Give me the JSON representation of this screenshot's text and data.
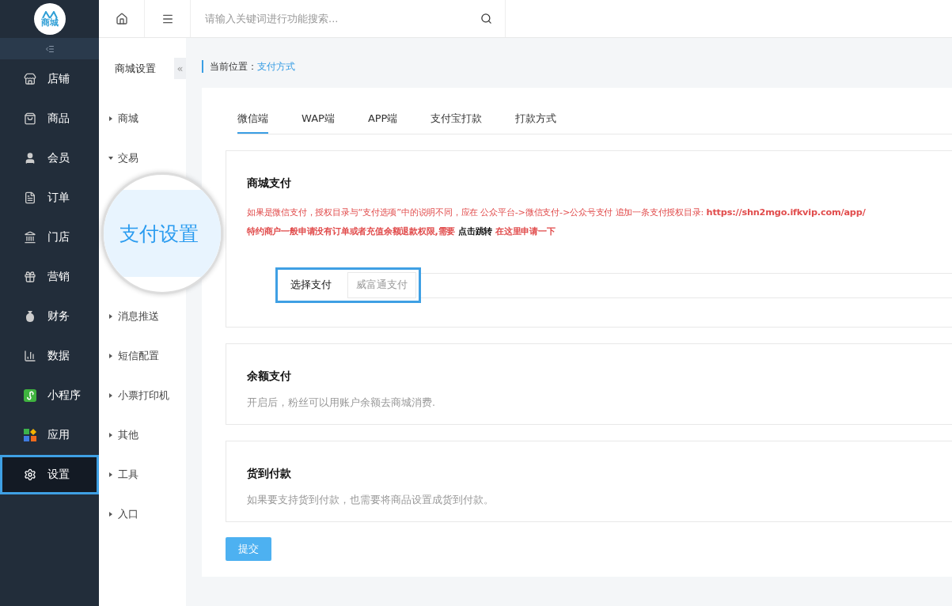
{
  "logo": {
    "text": "商城"
  },
  "sidebar": {
    "items": [
      {
        "label": "店铺",
        "selected": false
      },
      {
        "label": "商品",
        "selected": false
      },
      {
        "label": "会员",
        "selected": false
      },
      {
        "label": "订单",
        "selected": false
      },
      {
        "label": "门店",
        "selected": false
      },
      {
        "label": "营销",
        "selected": false
      },
      {
        "label": "财务",
        "selected": false
      },
      {
        "label": "数据",
        "selected": false
      },
      {
        "label": "小程序",
        "selected": false
      },
      {
        "label": "应用",
        "selected": false
      },
      {
        "label": "设置",
        "selected": true
      }
    ]
  },
  "topbar": {
    "search": {
      "placeholder": "请输入关键词进行功能搜索..."
    }
  },
  "subnav": {
    "title": "商城设置",
    "collapse": "«",
    "items": [
      {
        "label": "商城",
        "expanded": false
      },
      {
        "label": "交易",
        "expanded": true
      },
      {
        "label": "消息推送",
        "expanded": false
      },
      {
        "label": "短信配置",
        "expanded": false
      },
      {
        "label": "小票打印机",
        "expanded": false
      },
      {
        "label": "其他",
        "expanded": false
      },
      {
        "label": "工具",
        "expanded": false
      },
      {
        "label": "入口",
        "expanded": false
      }
    ]
  },
  "magnifier": {
    "text": "支付设置"
  },
  "breadcrumb": {
    "label": "当前位置：",
    "current": "支付方式"
  },
  "tabs": [
    {
      "label": "微信端",
      "selected": true
    },
    {
      "label": "WAP端",
      "selected": false
    },
    {
      "label": "APP端",
      "selected": false
    },
    {
      "label": "支付宝打款",
      "selected": false
    },
    {
      "label": "打款方式",
      "selected": false
    }
  ],
  "sections": [
    {
      "kind": "notice",
      "title": "商城支付",
      "line_1": "如果是微信支付，授权目录与“支付选项”中的说明不同，应在 公众平台->微信支付->公众号支付 追加一条支付授权目录: **https://shn2mgo.ifkvip.com/app/**",
      "line_2": "特约商户一般申请没有订单或者充值余额退款权限,需要",
      "link_1": "点击跳转",
      "link_2": "在这里申请一下",
      "select": {
        "label": "选择支付",
        "value": "威富通支付",
        "highlighted": true
      }
    },
    {
      "kind": "text",
      "title": "余额支付",
      "text": "开启后，粉丝可以用账户余额去商城消费."
    },
    {
      "kind": "text",
      "title": "货到付款",
      "text": "如果要支持货到付款，也需要将商品设置成货到付款。"
    }
  ],
  "submit": "提交"
}
